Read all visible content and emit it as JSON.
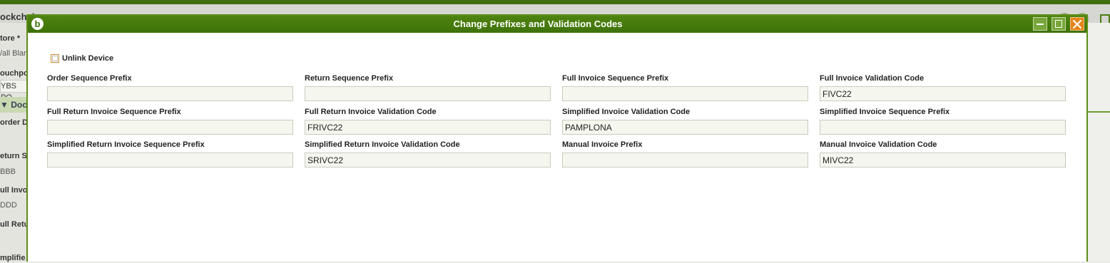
{
  "background": {
    "title": "ockchai",
    "labels": [
      "tore *",
      "ouchpo",
      "order Do",
      "eturn S",
      "ull Invo",
      "ull Retu",
      "mplifie"
    ],
    "values": [
      "/all Blan",
      "ΥBS PO",
      "BBB",
      "DDD"
    ],
    "section": "Doc"
  },
  "dialog": {
    "title": "Change Prefixes and Validation Codes",
    "unlink_label": "Unlink Device",
    "fields": [
      {
        "label": "Order Sequence Prefix",
        "value": ""
      },
      {
        "label": "Return Sequence Prefix",
        "value": ""
      },
      {
        "label": "Full Invoice Sequence Prefix",
        "value": ""
      },
      {
        "label": "Full Invoice Validation Code",
        "value": "FIVC22"
      },
      {
        "label": "Full Return Invoice Sequence Prefix",
        "value": ""
      },
      {
        "label": "Full Return Invoice Validation Code",
        "value": "FRIVC22"
      },
      {
        "label": "Simplified Invoice Validation Code",
        "value": "PAMPLONA"
      },
      {
        "label": "Simplified Invoice Sequence Prefix",
        "value": ""
      },
      {
        "label": "Simplified Return Invoice Sequence Prefix",
        "value": ""
      },
      {
        "label": "Simplified Return Invoice Validation Code",
        "value": "SRIVC22"
      },
      {
        "label": "Manual Invoice Prefix",
        "value": ""
      },
      {
        "label": "Manual Invoice Validation Code",
        "value": "MIVC22"
      }
    ]
  },
  "colors": {
    "header_green": "#4f8410",
    "close_orange": "#e58419",
    "input_bg": "#f5f6ee"
  },
  "icons": {
    "logo": "app-logo-icon",
    "minimize": "minimize-icon",
    "maximize": "maximize-icon",
    "close": "close-icon"
  }
}
